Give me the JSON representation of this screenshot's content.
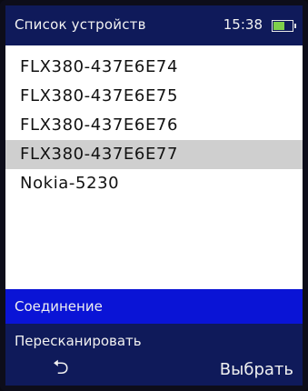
{
  "header": {
    "title": "Список устройств",
    "time": "15:38",
    "battery_level": 0.55
  },
  "devices": [
    {
      "label": "FLX380-437E6E74",
      "selected": false
    },
    {
      "label": "FLX380-437E6E75",
      "selected": false
    },
    {
      "label": "FLX380-437E6E76",
      "selected": false
    },
    {
      "label": "FLX380-437E6E77",
      "selected": true
    },
    {
      "label": "Nokia-5230",
      "selected": false
    }
  ],
  "menu": [
    {
      "label": "Соединение",
      "active": true
    },
    {
      "label": "Пересканировать",
      "active": false
    }
  ],
  "softkeys": {
    "back_icon": "back-arrow-icon",
    "back_glyph": "⮌",
    "select_label": "Выбрать"
  }
}
